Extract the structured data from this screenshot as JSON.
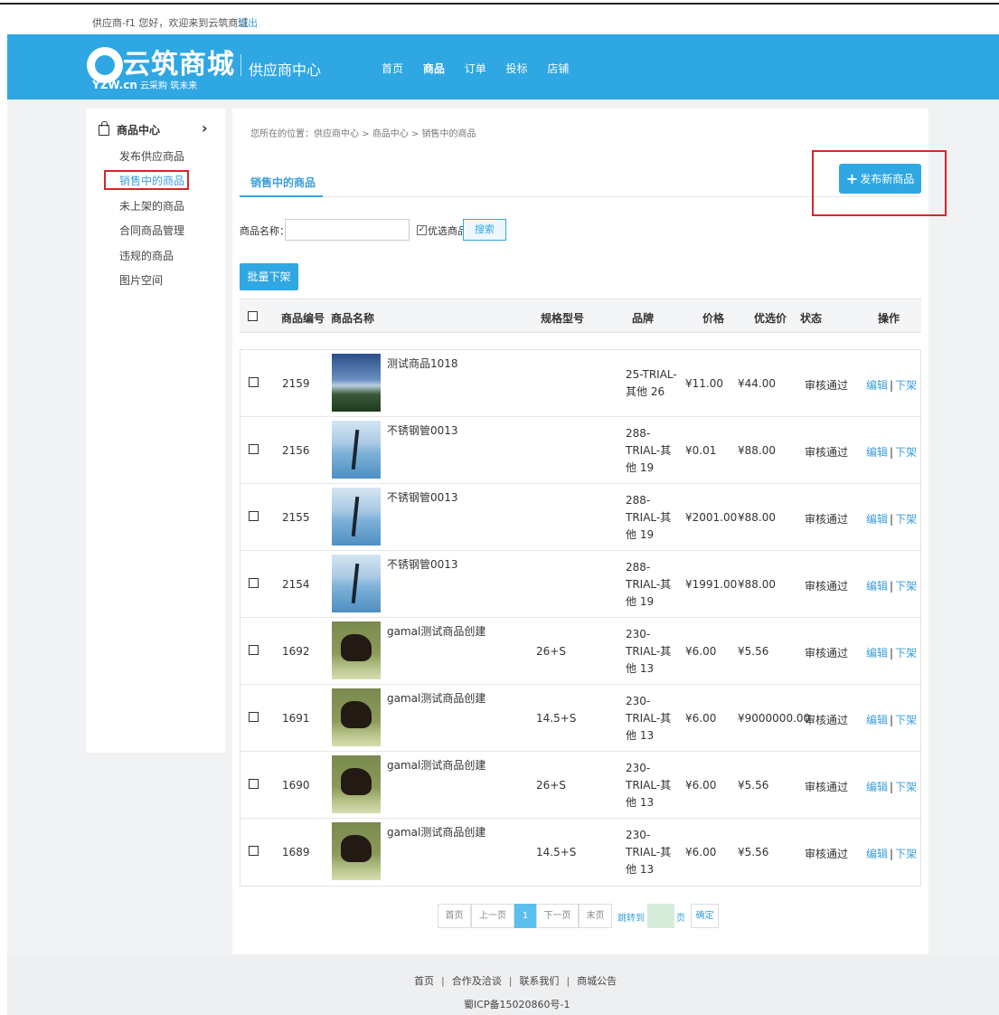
{
  "topbar": {
    "greeting": "供应商-f1 您好，欢迎来到云筑商城",
    "logout": "退出"
  },
  "header": {
    "brand": "云筑商城",
    "brand_domain": "YZW.cn",
    "brand_slogan": "云采购 筑未来",
    "center_title": "供应商中心",
    "nav": [
      "首页",
      "商品",
      "订单",
      "投标",
      "店铺"
    ],
    "nav_active": "商品"
  },
  "sidebar": {
    "title": "商品中心",
    "items": [
      "发布供应商品",
      "销售中的商品",
      "未上架的商品",
      "合同商品管理",
      "违规的商品",
      "图片空间"
    ],
    "active": "销售中的商品"
  },
  "main": {
    "breadcrumb": "您所在的位置：供应商中心 > 商品中心 > 销售中的商品",
    "tab": "销售中的商品",
    "publish_button": "发布新商品",
    "search": {
      "label": "商品名称：",
      "value": "",
      "optimal_label": "优选商品",
      "optimal_checked": true,
      "button": "搜索"
    },
    "batch_button": "批量下架",
    "columns": [
      "商品编号",
      "商品名称",
      "规格型号",
      "品牌",
      "价格",
      "优选价",
      "状态",
      "操作"
    ],
    "rows": [
      {
        "id": "2159",
        "name": "测试商品1018",
        "spec": "",
        "brand": "25-TRIAL-其他 26",
        "price": "¥11.00",
        "opt_price": "¥44.00",
        "status": "审核通过",
        "thumb": "night-landscape"
      },
      {
        "id": "2156",
        "name": "不锈钢管0013",
        "spec": "",
        "brand": "288-TRIAL-其他 19",
        "price": "¥0.01",
        "opt_price": "¥88.00",
        "status": "审核通过",
        "thumb": "runner-reflection"
      },
      {
        "id": "2155",
        "name": "不锈钢管0013",
        "spec": "",
        "brand": "288-TRIAL-其他 19",
        "price": "¥2001.00",
        "opt_price": "¥88.00",
        "status": "审核通过",
        "thumb": "runner-reflection"
      },
      {
        "id": "2154",
        "name": "不锈钢管0013",
        "spec": "",
        "brand": "288-TRIAL-其他 19",
        "price": "¥1991.00",
        "opt_price": "¥88.00",
        "status": "审核通过",
        "thumb": "runner-reflection"
      },
      {
        "id": "1692",
        "name": "gamal测试商品创建",
        "spec": "26+S",
        "brand": "230-TRIAL-其他 13",
        "price": "¥6.00",
        "opt_price": "¥5.56",
        "status": "审核通过",
        "thumb": "horse"
      },
      {
        "id": "1691",
        "name": "gamal测试商品创建",
        "spec": "14.5+S",
        "brand": "230-TRIAL-其他 13",
        "price": "¥6.00",
        "opt_price": "¥9000000.00",
        "status": "审核通过",
        "thumb": "horse"
      },
      {
        "id": "1690",
        "name": "gamal测试商品创建",
        "spec": "26+S",
        "brand": "230-TRIAL-其他 13",
        "price": "¥6.00",
        "opt_price": "¥5.56",
        "status": "审核通过",
        "thumb": "horse"
      },
      {
        "id": "1689",
        "name": "gamal测试商品创建",
        "spec": "14.5+S",
        "brand": "230-TRIAL-其他 13",
        "price": "¥6.00",
        "opt_price": "¥5.56",
        "status": "审核通过",
        "thumb": "horse"
      }
    ],
    "row_actions": {
      "edit": "编辑",
      "separator": "|",
      "unlist": "下架"
    },
    "pagination": {
      "first": "首页",
      "prev": "上一页",
      "current": "1",
      "next": "下一页",
      "last": "末页",
      "jump_label": "跳转到",
      "jump_value": "",
      "page_unit": "页",
      "confirm": "确定"
    }
  },
  "footer": {
    "links": [
      "首页",
      "合作及洽谈",
      "联系我们",
      "商城公告"
    ],
    "separator": "|",
    "icp": "蜀ICP备15020860号-1"
  },
  "colors": {
    "brand_blue": "#2fa7e2",
    "link_blue": "#3b9fd8",
    "highlight_red": "#d9252a"
  }
}
